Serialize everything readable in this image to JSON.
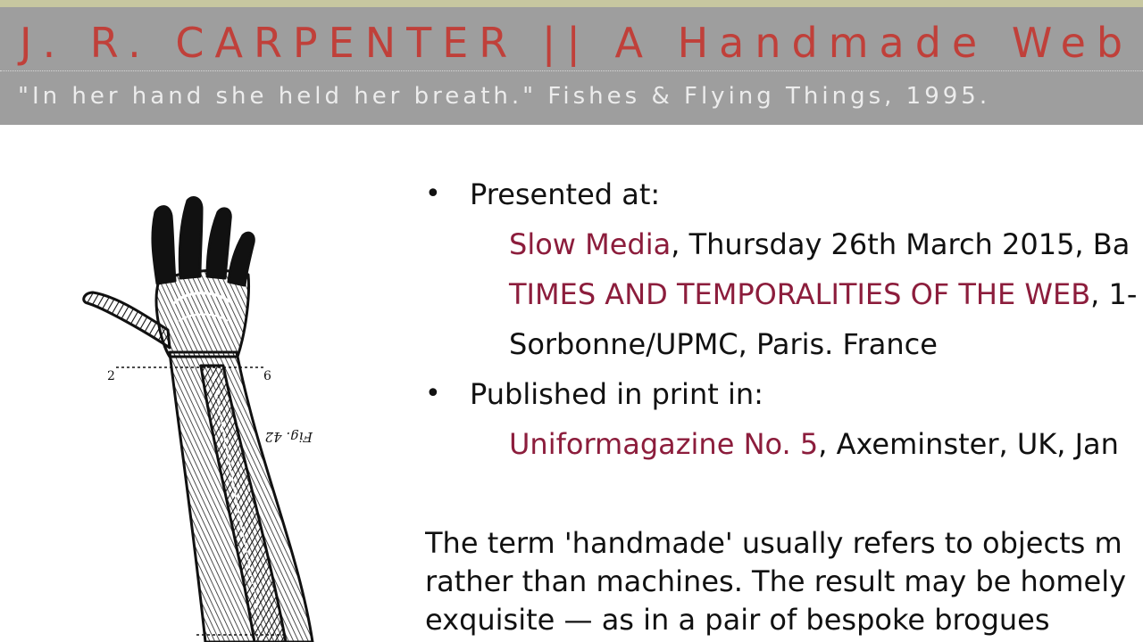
{
  "header": {
    "title": "J. R. CARPENTER || A Handmade Web",
    "tagline": "\"In her hand she held her breath.\" Fishes & Flying Things, 1995."
  },
  "illustration": {
    "icon": "anatomical-hand-arm-drawing",
    "labels": [
      "2",
      "6",
      "Fig. 42"
    ]
  },
  "sections": {
    "presented": {
      "heading": "Presented at:",
      "slow_media": {
        "link": "Slow Media",
        "rest": ", Thursday 26th March 2015, Ba"
      },
      "times": {
        "link": "TIMES AND TEMPORALITIES OF THE WEB",
        "rest": ", 1-"
      },
      "venue_line": "Sorbonne/UPMC, Paris. France"
    },
    "published": {
      "heading": "Published in print in:",
      "uniform": {
        "link": "Uniformagazine No. 5",
        "rest": ", Axeminster, UK, Jan"
      }
    }
  },
  "intro": {
    "line1": "The term 'handmade' usually refers to objects m",
    "line2": "rather than machines. The result may be homely",
    "line3": "exquisite — as in a pair of bespoke brogues"
  },
  "colors": {
    "title": "#c0403a",
    "link": "#8c1d3c",
    "header_bg": "#9e9e9e"
  }
}
